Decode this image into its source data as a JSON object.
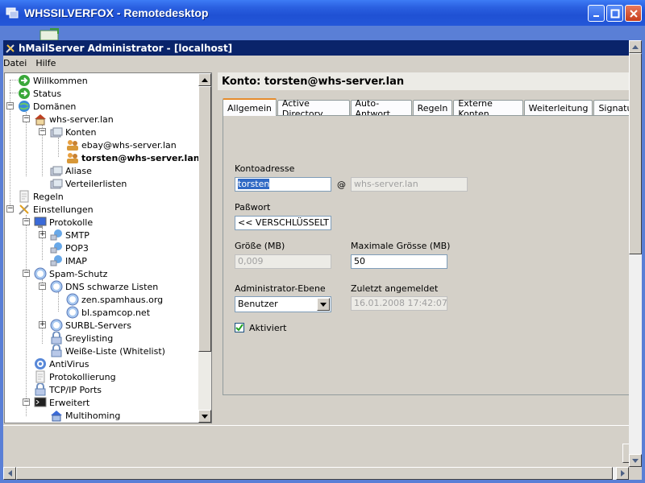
{
  "window": {
    "title": "WHSSILVERFOX - Remotedesktop"
  },
  "app": {
    "title": "hMailServer Administrator - [localhost]"
  },
  "menu": [
    {
      "label": "Datei"
    },
    {
      "label": "Hilfe"
    }
  ],
  "tree": {
    "items": [
      {
        "label": "Willkommen",
        "icon": "green-arrow-icon"
      },
      {
        "label": "Status",
        "icon": "green-arrow-icon"
      },
      {
        "label": "Domänen",
        "icon": "globe-icon"
      },
      {
        "label": "whs-server.lan",
        "icon": "house-icon"
      },
      {
        "label": "Konten",
        "icon": "folder-icon"
      },
      {
        "label": "ebay@whs-server.lan",
        "icon": "users-icon"
      },
      {
        "label": "torsten@whs-server.lan",
        "icon": "users-icon"
      },
      {
        "label": "Aliase",
        "icon": "folder-icon"
      },
      {
        "label": "Verteilerlisten",
        "icon": "folder-icon"
      },
      {
        "label": "Regeln",
        "icon": "document-icon"
      },
      {
        "label": "Einstellungen",
        "icon": "tools-icon"
      },
      {
        "label": "Protokolle",
        "icon": "monitor-icon"
      },
      {
        "label": "SMTP",
        "icon": "network-icon"
      },
      {
        "label": "POP3",
        "icon": "network-icon"
      },
      {
        "label": "IMAP",
        "icon": "network-icon"
      },
      {
        "label": "Spam-Schutz",
        "icon": "shield-icon"
      },
      {
        "label": "DNS schwarze Listen",
        "icon": "shield-icon"
      },
      {
        "label": "zen.spamhaus.org",
        "icon": "shield-icon"
      },
      {
        "label": "bl.spamcop.net",
        "icon": "shield-icon"
      },
      {
        "label": "SURBL-Servers",
        "icon": "shield-icon"
      },
      {
        "label": "Greylisting",
        "icon": "lock-icon"
      },
      {
        "label": "Weiße-Liste (Whitelist)",
        "icon": "lock-icon"
      },
      {
        "label": "AntiVirus",
        "icon": "target-icon"
      },
      {
        "label": "Protokollierung",
        "icon": "document-icon"
      },
      {
        "label": "TCP/IP Ports",
        "icon": "lock-icon"
      },
      {
        "label": "Erweitert",
        "icon": "terminal-icon"
      },
      {
        "label": "Multihoming",
        "icon": "house-icon"
      }
    ]
  },
  "account": {
    "header": "Konto: torsten@whs-server.lan",
    "tabs": [
      {
        "label": "Allgemein",
        "active": true
      },
      {
        "label": "Active Directory"
      },
      {
        "label": "Auto-Antwort"
      },
      {
        "label": "Regeln"
      },
      {
        "label": "Externe Konten"
      },
      {
        "label": "Weiterleitung"
      },
      {
        "label": "Signatur"
      }
    ],
    "address_label": "Kontoadresse",
    "address_value": "torsten",
    "at_sign": "@",
    "domain_value": "whs-server.lan",
    "password_label": "Paßwort",
    "password_value": "<< VERSCHLÜSSELT >>",
    "size_label": "Größe (MB)",
    "size_value": "0,009",
    "max_size_label": "Maximale Grösse (MB)",
    "max_size_value": "50",
    "admin_level_label": "Administrator-Ebene",
    "admin_level_value": "Benutzer",
    "last_login_label": "Zuletzt angemeldet",
    "last_login_value": "16.01.2008 17:42:07",
    "enabled_label": "Aktiviert",
    "enabled": true
  }
}
